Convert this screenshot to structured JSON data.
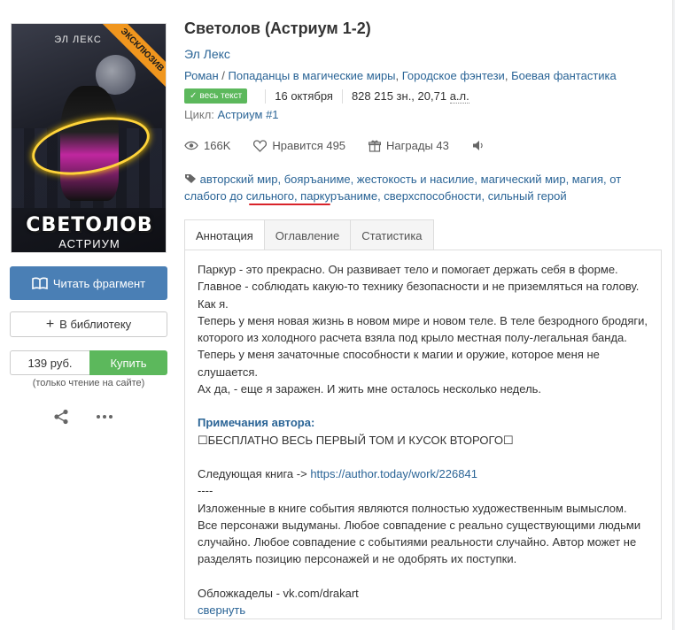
{
  "cover": {
    "author": "ЭЛ ЛЕКС",
    "ribbon": "ЭКСКЛЮЗИВ",
    "title": "СВЕТОЛОВ",
    "series": "АСТРИУМ"
  },
  "actions": {
    "read_fragment": "Читать фрагмент",
    "add_library": "В библиотеку",
    "price": "139 руб.",
    "buy": "Купить",
    "buy_note": "(только чтение на сайте)"
  },
  "book": {
    "title": "Светолов (Астриум 1-2)",
    "author": "Эл Лекс",
    "genres": [
      "Роман",
      "Попаданцы в магические миры",
      "Городское фэнтези",
      "Боевая фантастика"
    ],
    "badge": "весь текст",
    "date": "16 октября",
    "size": "828 215 зн., 20,71",
    "size_unit": "а.л.",
    "cycle_label": "Цикл:",
    "cycle": "Астриум #1"
  },
  "stats": {
    "views": "166K",
    "likes": "Нравится 495",
    "awards": "Награды 43"
  },
  "tags": [
    "авторский мир",
    "бояръаниме",
    "жестокость и насилие",
    "магический мир",
    "магия",
    "от слабого до сильного",
    "паркуръаниме",
    "сверхспособности",
    "сильный герой"
  ],
  "tabs": [
    "Аннотация",
    "Оглавление",
    "Статистика"
  ],
  "annotation": {
    "p1": "Паркур - это прекрасно. Он развивает тело и помогает держать себя в форме. Главное - соблюдать какую-то технику безопасности и не приземляться на голову. Как я.",
    "p2": "Теперь у меня новая жизнь в новом мире и новом теле. В теле безродного бродяги, которого из холодного расчета взяла под крыло местная полу-легальная банда.",
    "p3": "Теперь у меня зачаточные способности к магии и оружие, которое меня не слушается.",
    "p4": "Ах да, - еще я заражен. И жить мне осталось несколько недель.",
    "notes_title": "Примечания автора:",
    "notes_line": "☐БЕСПЛАТНО ВЕСЬ ПЕРВЫЙ ТОМ И КУСОК ВТОРОГО☐",
    "next_label": "Следующая книга ->",
    "next_link": "https://author.today/work/226841",
    "dashes": "----",
    "disclaimer": "Изложенные в книге события являются полностью художественным вымыслом. Все персонажи выдуманы. Любое совпадение с реально существующими людьми случайно. Любое совпадение с событиями реальности случайно. Автор может не разделять позицию персонажей и не одобрять их поступки.",
    "cover_credit": "Обложкаделы - vk.com/drakart",
    "collapse": "свернуть"
  },
  "colors": {
    "link": "#2a6496",
    "primary_button": "#4a7fb5",
    "buy_button": "#5cb85c",
    "highlight_underline": "#d9232a",
    "ribbon": "#f0961e"
  }
}
